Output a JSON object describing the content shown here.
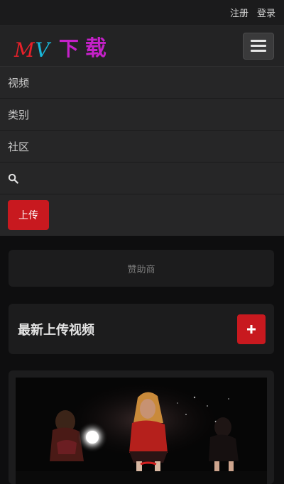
{
  "topbar": {
    "register": "注册",
    "login": "登录"
  },
  "brand": {
    "m": "M",
    "v": "V",
    "cn1": "下",
    "cn2": "载"
  },
  "menu": {
    "items": [
      {
        "label": "视频"
      },
      {
        "label": "类别"
      },
      {
        "label": "社区"
      }
    ],
    "upload_label": "上传"
  },
  "sponsor": {
    "text": "赞助商"
  },
  "latest": {
    "title": "最新上传视频"
  },
  "colors": {
    "accent": "#c8191f",
    "logo_red": "#e8202a",
    "logo_cyan": "#19b7d9",
    "logo_magenta": "#c521c9"
  },
  "icons": {
    "search": "search-icon",
    "menu": "hamburger-icon",
    "add": "plus-icon"
  }
}
